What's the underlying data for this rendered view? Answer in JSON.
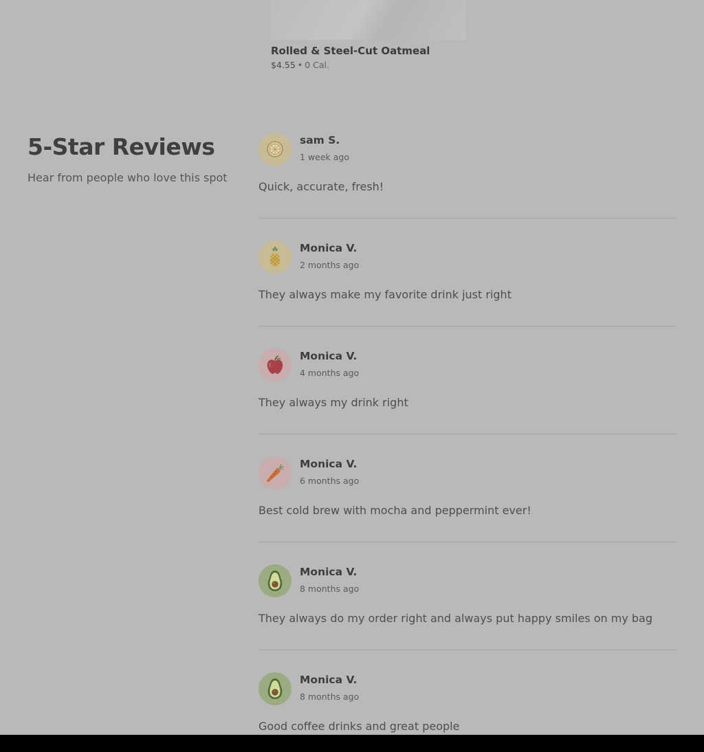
{
  "product": {
    "name": "Rolled & Steel-Cut Oatmeal",
    "price": "$4.55",
    "separator": "•",
    "calories": "0 Cal."
  },
  "reviews_section": {
    "title": "5-Star Reviews",
    "subtitle": "Hear from people who love this spot"
  },
  "reviews": [
    {
      "name": "sam S.",
      "time": "1 week ago",
      "text": "Quick, accurate, fresh!",
      "avatar_icon": "lemon-icon",
      "avatar_color": "#c8bc96"
    },
    {
      "name": "Monica V.",
      "time": "2 months ago",
      "text": "They always make my favorite drink just right",
      "avatar_icon": "pineapple-icon",
      "avatar_color": "#c8bc96"
    },
    {
      "name": "Monica V.",
      "time": "4 months ago",
      "text": "They always my drink right",
      "avatar_icon": "apple-icon",
      "avatar_color": "#c9adad"
    },
    {
      "name": "Monica V.",
      "time": "6 months ago",
      "text": "Best cold brew with mocha and peppermint ever!",
      "avatar_icon": "carrot-icon",
      "avatar_color": "#c9adad"
    },
    {
      "name": "Monica V.",
      "time": "8 months ago",
      "text": "They always do my order right and always put happy smiles on my bag",
      "avatar_icon": "avocado-icon",
      "avatar_color": "#9bab82"
    },
    {
      "name": "Monica V.",
      "time": "8 months ago",
      "text": "Good coffee drinks and great people",
      "avatar_icon": "avocado-icon",
      "avatar_color": "#9bab82"
    }
  ]
}
